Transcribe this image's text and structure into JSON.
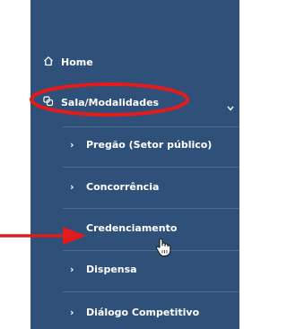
{
  "sidebar": {
    "home": {
      "label": "Home",
      "icon": "home-icon"
    },
    "sala": {
      "label": "Sala/Modalidades",
      "icon": "rooms-icon",
      "expanded": true
    },
    "subitems": [
      {
        "label": "Pregão (Setor público)",
        "has_bullet": true
      },
      {
        "label": "Concorrência",
        "has_bullet": true
      },
      {
        "label": "Credenciamento",
        "has_bullet": false
      },
      {
        "label": "Dispensa",
        "has_bullet": true
      },
      {
        "label": "Diálogo Competitivo",
        "has_bullet": true
      }
    ],
    "bullet_glyph": "›"
  },
  "annotations": {
    "highlight_color": "#e21c1c",
    "arrow_color": "#e21c1c",
    "arrow_target": "Credenciamento"
  },
  "colors": {
    "sidebar_bg": "#2e5079",
    "text": "#ffffff"
  }
}
